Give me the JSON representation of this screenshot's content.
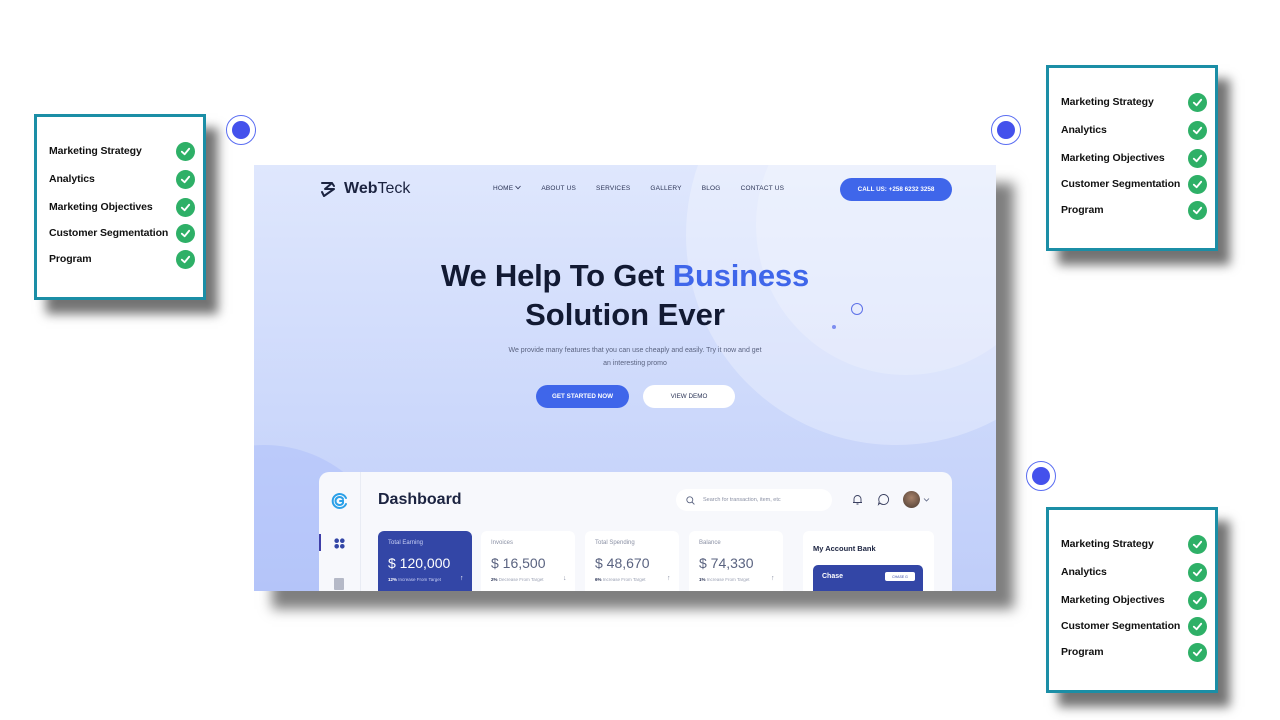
{
  "checklist": {
    "items": [
      "Marketing Strategy",
      "Analytics",
      "Marketing Objectives",
      "Customer Segmentation",
      "Program"
    ],
    "check_color": "#2eb067",
    "border_color": "#1b8ea6"
  },
  "site": {
    "logo": {
      "bold": "Web",
      "normal": "Teck"
    },
    "nav": [
      "HOME",
      "ABOUT US",
      "SERVICES",
      "GALLERY",
      "BLOG",
      "CONTACT US"
    ],
    "call_button": "CALL US: +258 6232 3258",
    "hero": {
      "line1_plain": "We Help To Get ",
      "line1_accent": "Business",
      "line2": "Solution Ever"
    },
    "subtitle": "We provide many features that you can use cheaply and easily. Try it now and get an interesting promo",
    "buttons": {
      "primary": "GET STARTED NOW",
      "secondary": "VIEW DEMO"
    },
    "accent_color": "#3f66ea"
  },
  "dashboard": {
    "title": "Dashboard",
    "search_placeholder": "Search for transaction, item, etc",
    "stats": [
      {
        "title": "Total Earning",
        "value": "$ 120,000",
        "pct": "12%",
        "note": "Increase From Target",
        "arrow": "↑"
      },
      {
        "title": "Invoices",
        "value": "$ 16,500",
        "pct": "2%",
        "note": "Decrease From Target",
        "arrow": "↓"
      },
      {
        "title": "Total Spending",
        "value": "$ 48,670",
        "pct": "6%",
        "note": "Increase From Target",
        "arrow": "↑"
      },
      {
        "title": "Balance",
        "value": "$ 74,330",
        "pct": "1%",
        "note": "Increase From Target",
        "arrow": "↑"
      }
    ],
    "bank": {
      "title": "My Account Bank",
      "card_name": "Chase",
      "card_button": "CHASE G"
    }
  }
}
